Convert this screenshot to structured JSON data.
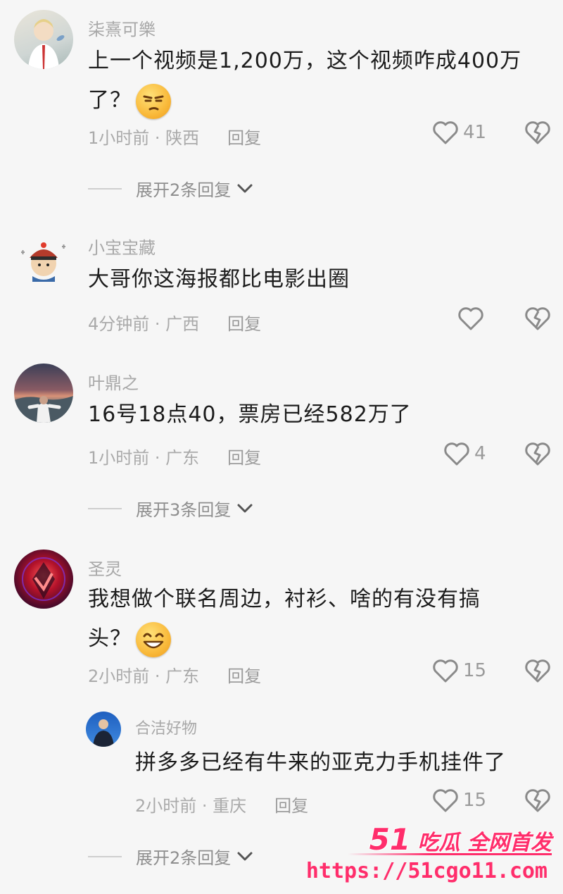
{
  "comments": [
    {
      "username": "柒熹可樂",
      "text_line1": "上一个视频是1,200万，这个视频咋成400万",
      "text_line2": "了？",
      "emoji": "smirk-emoji",
      "time_location": "1小时前 · 陕西",
      "reply_label": "回复",
      "likes": "41",
      "expand_label": "展开2条回复"
    },
    {
      "username": "小宝宝藏",
      "text_line1": "大哥你这海报都比电影出圈",
      "time_location": "4分钟前 · 广西",
      "reply_label": "回复",
      "likes": ""
    },
    {
      "username": "叶鼎之",
      "text_line1": "16号18点40，票房已经582万了",
      "time_location": "1小时前 · 广东",
      "reply_label": "回复",
      "likes": "4",
      "expand_label": "展开3条回复"
    },
    {
      "username": "圣灵",
      "text_line1": "我想做个联名周边，衬衫、啥的有没有搞",
      "text_line2": "头？",
      "emoji": "grin-emoji",
      "time_location": "2小时前 · 广东",
      "reply_label": "回复",
      "likes": "15"
    }
  ],
  "reply": {
    "username": "合洁好物",
    "text_line1": "拼多多已经有牛来的亚克力手机挂件了",
    "time_location": "2小时前 · 重庆",
    "reply_label": "回复",
    "likes": "15",
    "expand_label": "展开2条回复"
  },
  "watermark": {
    "number": "51",
    "slogan": "吃瓜 全网首发",
    "url": "https://51cgo11.com"
  },
  "colors": {
    "background": "#f6f6f6",
    "accent_watermark": "#ff2d6b"
  }
}
